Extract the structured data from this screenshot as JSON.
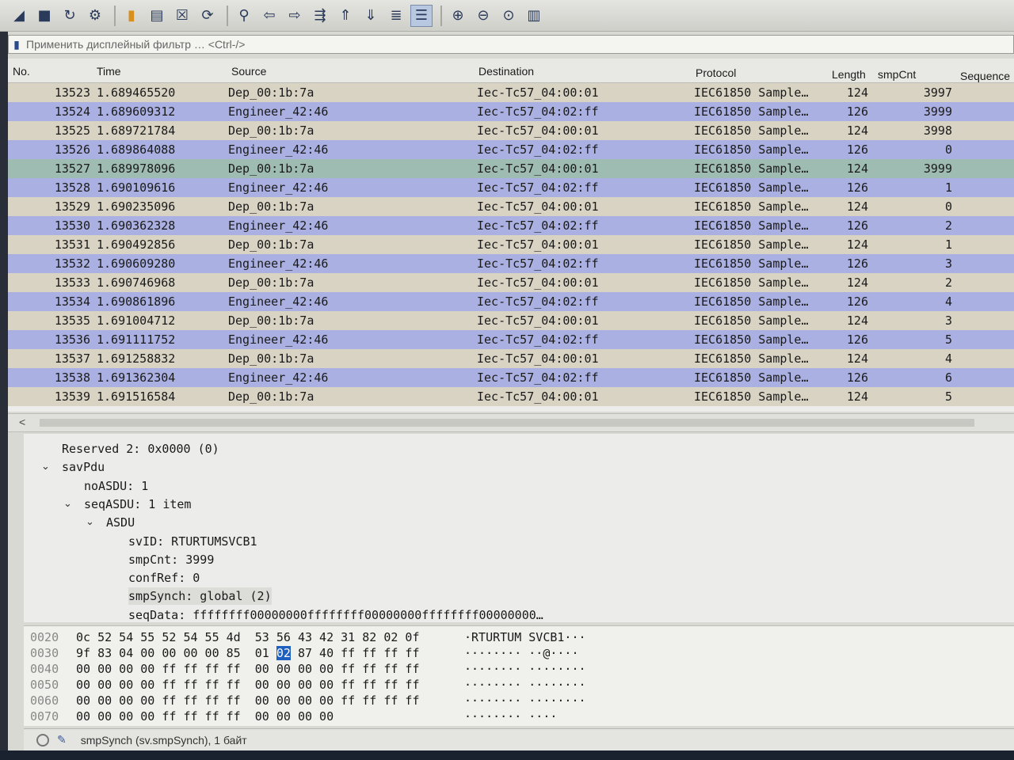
{
  "toolbar": {
    "icons": [
      "shark-fin-icon",
      "stop-icon",
      "restart-icon",
      "options-icon",
      "open-file-icon",
      "save-icon",
      "close-file-icon",
      "reload-icon",
      "find-icon",
      "back-icon",
      "forward-icon",
      "goto-icon",
      "first-icon",
      "last-icon",
      "autoscroll-icon",
      "colorize-icon",
      "zoom-in-icon",
      "zoom-out-icon",
      "zoom-reset-icon",
      "resize-columns-icon"
    ]
  },
  "filter": {
    "placeholder": "Применить дисплейный фильтр … <Ctrl-/>"
  },
  "columns": {
    "no": "No.",
    "time": "Time",
    "source": "Source",
    "destination": "Destination",
    "protocol": "Protocol",
    "length": "Length",
    "smpcnt": "smpCnt",
    "sequence": "Sequence"
  },
  "packets": [
    {
      "no": "13523",
      "time": "1.689465520",
      "src": "Dep_00:1b:7a",
      "dst": "Iec-Tc57_04:00:01",
      "proto": "IEC61850 Sample…",
      "len": "124",
      "smp": "3997",
      "kind": "dep"
    },
    {
      "no": "13524",
      "time": "1.689609312",
      "src": "Engineer_42:46",
      "dst": "Iec-Tc57_04:02:ff",
      "proto": "IEC61850 Sample…",
      "len": "126",
      "smp": "3999",
      "kind": "eng"
    },
    {
      "no": "13525",
      "time": "1.689721784",
      "src": "Dep_00:1b:7a",
      "dst": "Iec-Tc57_04:00:01",
      "proto": "IEC61850 Sample…",
      "len": "124",
      "smp": "3998",
      "kind": "dep"
    },
    {
      "no": "13526",
      "time": "1.689864088",
      "src": "Engineer_42:46",
      "dst": "Iec-Tc57_04:02:ff",
      "proto": "IEC61850 Sample…",
      "len": "126",
      "smp": "0",
      "kind": "eng"
    },
    {
      "no": "13527",
      "time": "1.689978096",
      "src": "Dep_00:1b:7a",
      "dst": "Iec-Tc57_04:00:01",
      "proto": "IEC61850 Sample…",
      "len": "124",
      "smp": "3999",
      "kind": "sel"
    },
    {
      "no": "13528",
      "time": "1.690109616",
      "src": "Engineer_42:46",
      "dst": "Iec-Tc57_04:02:ff",
      "proto": "IEC61850 Sample…",
      "len": "126",
      "smp": "1",
      "kind": "eng"
    },
    {
      "no": "13529",
      "time": "1.690235096",
      "src": "Dep_00:1b:7a",
      "dst": "Iec-Tc57_04:00:01",
      "proto": "IEC61850 Sample…",
      "len": "124",
      "smp": "0",
      "kind": "dep"
    },
    {
      "no": "13530",
      "time": "1.690362328",
      "src": "Engineer_42:46",
      "dst": "Iec-Tc57_04:02:ff",
      "proto": "IEC61850 Sample…",
      "len": "126",
      "smp": "2",
      "kind": "eng"
    },
    {
      "no": "13531",
      "time": "1.690492856",
      "src": "Dep_00:1b:7a",
      "dst": "Iec-Tc57_04:00:01",
      "proto": "IEC61850 Sample…",
      "len": "124",
      "smp": "1",
      "kind": "dep"
    },
    {
      "no": "13532",
      "time": "1.690609280",
      "src": "Engineer_42:46",
      "dst": "Iec-Tc57_04:02:ff",
      "proto": "IEC61850 Sample…",
      "len": "126",
      "smp": "3",
      "kind": "eng"
    },
    {
      "no": "13533",
      "time": "1.690746968",
      "src": "Dep_00:1b:7a",
      "dst": "Iec-Tc57_04:00:01",
      "proto": "IEC61850 Sample…",
      "len": "124",
      "smp": "2",
      "kind": "dep"
    },
    {
      "no": "13534",
      "time": "1.690861896",
      "src": "Engineer_42:46",
      "dst": "Iec-Tc57_04:02:ff",
      "proto": "IEC61850 Sample…",
      "len": "126",
      "smp": "4",
      "kind": "eng"
    },
    {
      "no": "13535",
      "time": "1.691004712",
      "src": "Dep_00:1b:7a",
      "dst": "Iec-Tc57_04:00:01",
      "proto": "IEC61850 Sample…",
      "len": "124",
      "smp": "3",
      "kind": "dep"
    },
    {
      "no": "13536",
      "time": "1.691111752",
      "src": "Engineer_42:46",
      "dst": "Iec-Tc57_04:02:ff",
      "proto": "IEC61850 Sample…",
      "len": "126",
      "smp": "5",
      "kind": "eng"
    },
    {
      "no": "13537",
      "time": "1.691258832",
      "src": "Dep_00:1b:7a",
      "dst": "Iec-Tc57_04:00:01",
      "proto": "IEC61850 Sample…",
      "len": "124",
      "smp": "4",
      "kind": "dep"
    },
    {
      "no": "13538",
      "time": "1.691362304",
      "src": "Engineer_42:46",
      "dst": "Iec-Tc57_04:02:ff",
      "proto": "IEC61850 Sample…",
      "len": "126",
      "smp": "6",
      "kind": "eng"
    },
    {
      "no": "13539",
      "time": "1.691516584",
      "src": "Dep_00:1b:7a",
      "dst": "Iec-Tc57_04:00:01",
      "proto": "IEC61850 Sample…",
      "len": "124",
      "smp": "5",
      "kind": "dep"
    }
  ],
  "details": [
    {
      "text": "Reserved 2: 0x0000 (0)",
      "indent": 1,
      "caret": ""
    },
    {
      "text": "savPdu",
      "indent": 1,
      "caret": "open"
    },
    {
      "text": "noASDU: 1",
      "indent": 2,
      "caret": ""
    },
    {
      "text": "seqASDU: 1 item",
      "indent": 2,
      "caret": "open"
    },
    {
      "text": "ASDU",
      "indent": 3,
      "caret": "open"
    },
    {
      "text": "svID: RTURTUMSVCB1",
      "indent": 4,
      "caret": ""
    },
    {
      "text": "smpCnt: 3999",
      "indent": 4,
      "caret": ""
    },
    {
      "text": "confRef: 0",
      "indent": 4,
      "caret": ""
    },
    {
      "text": "smpSynch: global (2)",
      "indent": 4,
      "caret": "",
      "highlight": true
    },
    {
      "text": "seqData: ffffffff00000000ffffffff00000000ffffffff00000000…",
      "indent": 4,
      "caret": ""
    }
  ],
  "hex": [
    {
      "off": "0020",
      "pre": "0c 52 54 55 52 54 55 4d  53 56 43 42 31 82 02 0f",
      "sel": "",
      "post": "",
      "ascii": "·RTURTUM SVCB1···"
    },
    {
      "off": "0030",
      "pre": "9f 83 04 00 00 00 00 85  01 ",
      "sel": "02",
      "post": " 87 40 ff ff ff ff",
      "ascii": "········ ··@····"
    },
    {
      "off": "0040",
      "pre": "00 00 00 00 ff ff ff ff  00 00 00 00 ff ff ff ff",
      "sel": "",
      "post": "",
      "ascii": "········ ········"
    },
    {
      "off": "0050",
      "pre": "00 00 00 00 ff ff ff ff  00 00 00 00 ff ff ff ff",
      "sel": "",
      "post": "",
      "ascii": "········ ········"
    },
    {
      "off": "0060",
      "pre": "00 00 00 00 ff ff ff ff  00 00 00 00 ff ff ff ff",
      "sel": "",
      "post": "",
      "ascii": "········ ········"
    },
    {
      "off": "0070",
      "pre": "00 00 00 00 ff ff ff ff  00 00 00 00",
      "sel": "",
      "post": "",
      "ascii": "········ ····"
    }
  ],
  "status": {
    "text": "smpSynch (sv.smpSynch), 1 байт"
  },
  "colors": {
    "dep_row": "#d8d3c3",
    "eng_row": "#aab0e2",
    "selected_row": "#9fbcb2",
    "hex_selection": "#1f5fbf"
  }
}
